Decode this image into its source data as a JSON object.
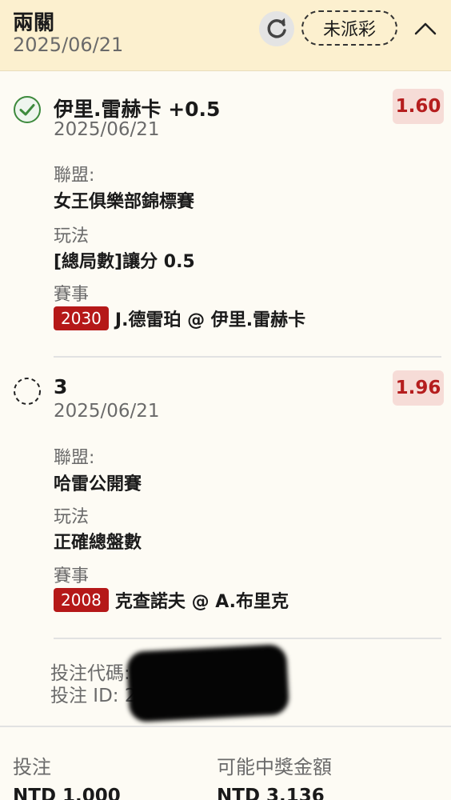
{
  "header": {
    "title": "兩關",
    "date": "2025/06/21",
    "status": "未派彩",
    "refresh_icon": "refresh-icon",
    "collapse_icon": "chevron-up-icon"
  },
  "legs": [
    {
      "status_icon": "check-circle-icon",
      "title": "伊里.雷赫卡 +0.5",
      "date": "2025/06/21",
      "odds": "1.60",
      "league_label": "聯盟:",
      "league": "女王俱樂部錦標賽",
      "market_label": "玩法",
      "market": "[總局數]讓分 0.5",
      "event_label": "賽事",
      "match_id": "2030",
      "match": "J.德雷珀 @ 伊里.雷赫卡"
    },
    {
      "status_icon": "pending-dashed-circle-icon",
      "title": "3",
      "date": "2025/06/21",
      "odds": "1.96",
      "league_label": "聯盟:",
      "league": "哈雷公開賽",
      "market_label": "玩法",
      "market": "正確總盤數",
      "event_label": "賽事",
      "match_id": "2008",
      "match": "克查諾夫 @ A.布里克"
    }
  ],
  "bet_info": {
    "code_label": "投注代碼::",
    "id_label": "投注 ID: 2"
  },
  "footer": {
    "stake_label": "投注",
    "stake_value": "NTD 1,000",
    "payout_label": "可能中獎金額",
    "payout_value": "NTD 3,136"
  },
  "colors": {
    "header_bg": "#fcf0cf",
    "accent_red": "#b51818",
    "odds_bg": "#f6dcd7",
    "check_green": "#3d8a3d"
  }
}
